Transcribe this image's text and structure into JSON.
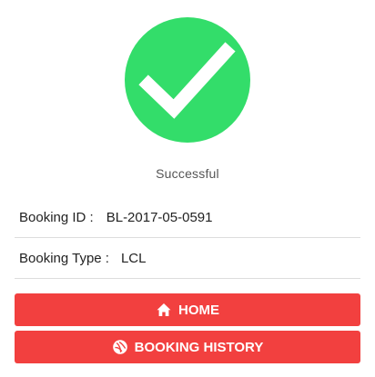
{
  "status": {
    "icon": "check-circle-icon",
    "accent_color": "#33dd6a",
    "text": "Successful"
  },
  "details": {
    "booking_id_label": "Booking ID :",
    "booking_id_value": "BL-2017-05-0591",
    "booking_type_label": "Booking Type :",
    "booking_type_value": "LCL"
  },
  "actions": {
    "home_label": "HOME",
    "home_icon": "home-icon",
    "history_label": "BOOKING HISTORY",
    "history_icon": "booking-history-icon",
    "button_color": "#f2403f"
  }
}
